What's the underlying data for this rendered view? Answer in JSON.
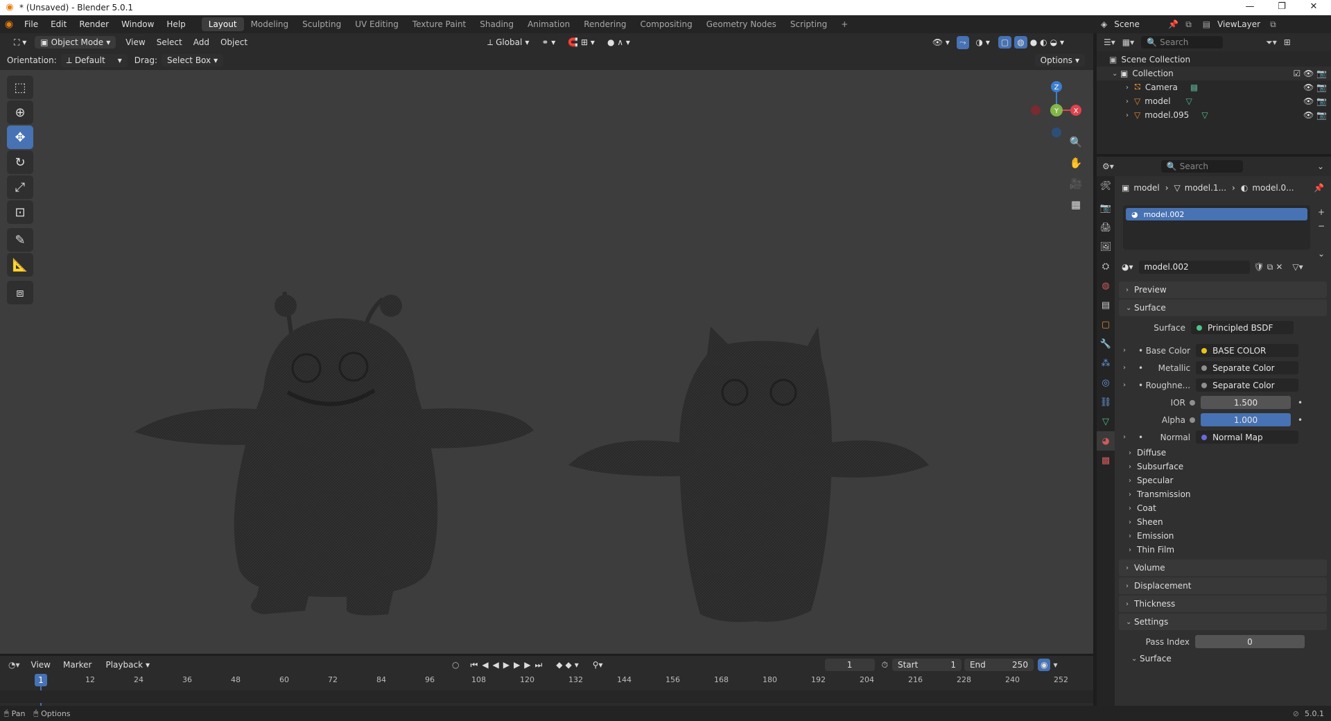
{
  "window": {
    "title": "* (Unsaved) - Blender 5.0.1",
    "min_glyph": "—",
    "max_glyph": "❐",
    "close_glyph": "✕"
  },
  "menu": [
    "File",
    "Edit",
    "Render",
    "Window",
    "Help"
  ],
  "workspaces": [
    "Layout",
    "Modeling",
    "Sculpting",
    "UV Editing",
    "Texture Paint",
    "Shading",
    "Animation",
    "Rendering",
    "Compositing",
    "Geometry Nodes",
    "Scripting"
  ],
  "workspace_add": "+",
  "scene": {
    "label": "Scene",
    "view_layer": "ViewLayer"
  },
  "viewport_header": {
    "mode": "Object Mode",
    "view": "View",
    "select": "Select",
    "add": "Add",
    "object": "Object",
    "transform": "Global"
  },
  "tool_header": {
    "orientation_label": "Orientation:",
    "orientation_value": "Default",
    "drag_label": "Drag:",
    "drag_value": "Select Box",
    "options": "Options"
  },
  "gizmo": {
    "z": "Z",
    "y": "Y",
    "x": "X"
  },
  "outliner": {
    "search_placeholder": "Search",
    "scene_collection": "Scene Collection",
    "collection": "Collection",
    "items": [
      "Camera",
      "model",
      "model.095"
    ]
  },
  "properties": {
    "search_placeholder": "Search",
    "breadcrumb": [
      "model",
      "model.1...",
      "model.0..."
    ],
    "slot_name": "model.002",
    "material_name": "model.002",
    "panels": {
      "preview": "Preview",
      "surface": "Surface"
    },
    "surface_row": {
      "label": "Surface",
      "value": "Principled BSDF"
    },
    "inputs": [
      {
        "label": "Base Color",
        "value": "BASE COLOR",
        "color": "#e6c419"
      },
      {
        "label": "Metallic",
        "value": "Separate Color",
        "color": "#8f8f8f"
      },
      {
        "label": "Roughne...",
        "value": "Separate Color",
        "color": "#8f8f8f"
      }
    ],
    "ior": {
      "label": "IOR",
      "value": "1.500"
    },
    "alpha": {
      "label": "Alpha",
      "value": "1.000"
    },
    "normal": {
      "label": "Normal",
      "value": "Normal Map"
    },
    "subpanels": [
      "Diffuse",
      "Subsurface",
      "Specular",
      "Transmission",
      "Coat",
      "Sheen",
      "Emission",
      "Thin Film"
    ],
    "bottom_panels": [
      "Volume",
      "Displacement",
      "Thickness"
    ],
    "settings": {
      "label": "Settings",
      "pass_index_label": "Pass Index",
      "pass_index_value": "0",
      "surface_sub": "Surface"
    }
  },
  "timeline": {
    "view": "View",
    "marker": "Marker",
    "playback": "Playback",
    "current_frame": "1",
    "start_label": "Start",
    "start_value": "1",
    "end_label": "End",
    "end_value": "250",
    "ticks": [
      "1",
      "12",
      "24",
      "36",
      "48",
      "60",
      "72",
      "84",
      "96",
      "108",
      "120",
      "132",
      "144",
      "156",
      "168",
      "180",
      "192",
      "204",
      "216",
      "228",
      "240",
      "252"
    ]
  },
  "status": {
    "pan": "Pan",
    "options": "Options",
    "version": "5.0.1"
  },
  "colors": {
    "accent": "#4772b3",
    "x_axis": "#e0434d",
    "y_axis": "#8bc34a",
    "z_axis": "#3b7fd1"
  }
}
